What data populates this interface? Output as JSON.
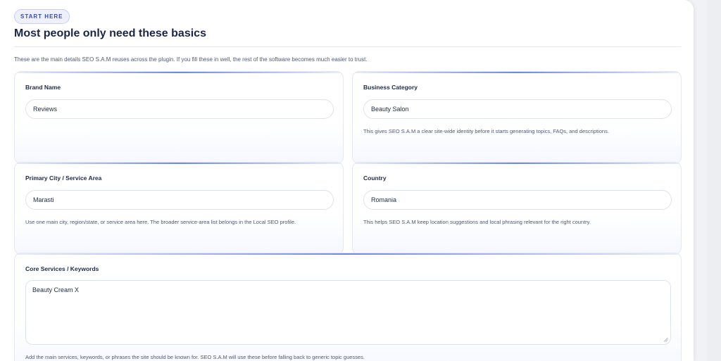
{
  "section": {
    "badge": "START HERE",
    "title": "Most people only need these basics",
    "intro": "These are the main details SEO S.A.M reuses across the plugin. If you fill these in well, the rest of the software becomes much easier to trust."
  },
  "fields": {
    "brand_name": {
      "label": "Brand Name",
      "value": "Reviews"
    },
    "business_category": {
      "label": "Business Category",
      "value": "Beauty Salon",
      "help": "This gives SEO S.A.M a clear site-wide identity before it starts generating topics, FAQs, and descriptions."
    },
    "primary_city": {
      "label": "Primary City / Service Area",
      "value": "Marasti",
      "help": "Use one main city, region/state, or service area here. The broader service-area list belongs in the Local SEO profile."
    },
    "country": {
      "label": "Country",
      "value": "Romania",
      "help": "This helps SEO S.A.M keep location suggestions and local phrasing relevant for the right country."
    },
    "core_services": {
      "label": "Core Services / Keywords",
      "value": "Beauty Cream X",
      "help": "Add the main services, keywords, or phrases the site should be known for. SEO S.A.M will use these before falling back to generic topic guesses."
    }
  },
  "colors": {
    "accent": "#6f86e6",
    "badge_text": "#3b4bb0",
    "heading": "#1b2545"
  }
}
